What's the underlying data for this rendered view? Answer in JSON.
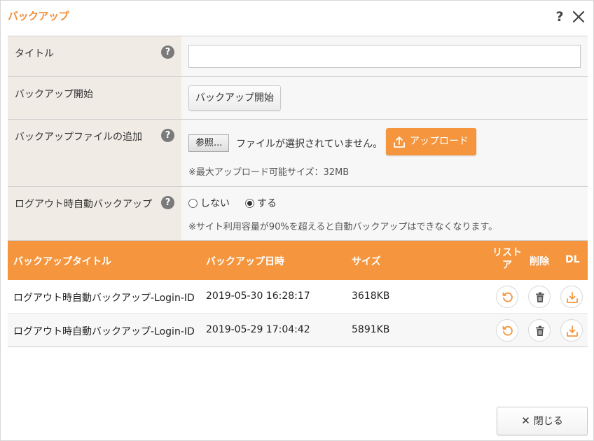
{
  "dialog": {
    "title": "バックアップ",
    "help_glyph": "?"
  },
  "form": {
    "title_label": "タイトル",
    "title_value": "",
    "start_label": "バックアップ開始",
    "start_button": "バックアップ開始",
    "add_label": "バックアップファイルの追加",
    "browse_button": "参照...",
    "file_status": "ファイルが選択されていません。",
    "upload_button": "アップロード",
    "max_size_note": "※最大アップロード可能サイズ：32MB",
    "auto_label": "ログアウト時自動バックアップ",
    "auto_options": [
      "しない",
      "する"
    ],
    "auto_selected": "する",
    "auto_note": "※サイト利用容量が90%を超えると自動バックアップはできなくなります。"
  },
  "table": {
    "headers": {
      "title": "バックアップタイトル",
      "datetime": "バックアップ日時",
      "size": "サイズ",
      "restore_line1": "リスト",
      "restore_line2": "ア",
      "delete": "削除",
      "dl": "DL"
    },
    "rows": [
      {
        "title": "ログアウト時自動バックアップ-Login-ID",
        "datetime": "2019-05-30 16:28:17",
        "size": "3618KB"
      },
      {
        "title": "ログアウト時自動バックアップ-Login-ID",
        "datetime": "2019-05-29 17:04:42",
        "size": "5891KB"
      }
    ]
  },
  "footer": {
    "close_button": "閉じる"
  },
  "colors": {
    "accent": "#f5963e",
    "title": "#f0903a",
    "label_bg": "#f0ebe5"
  }
}
